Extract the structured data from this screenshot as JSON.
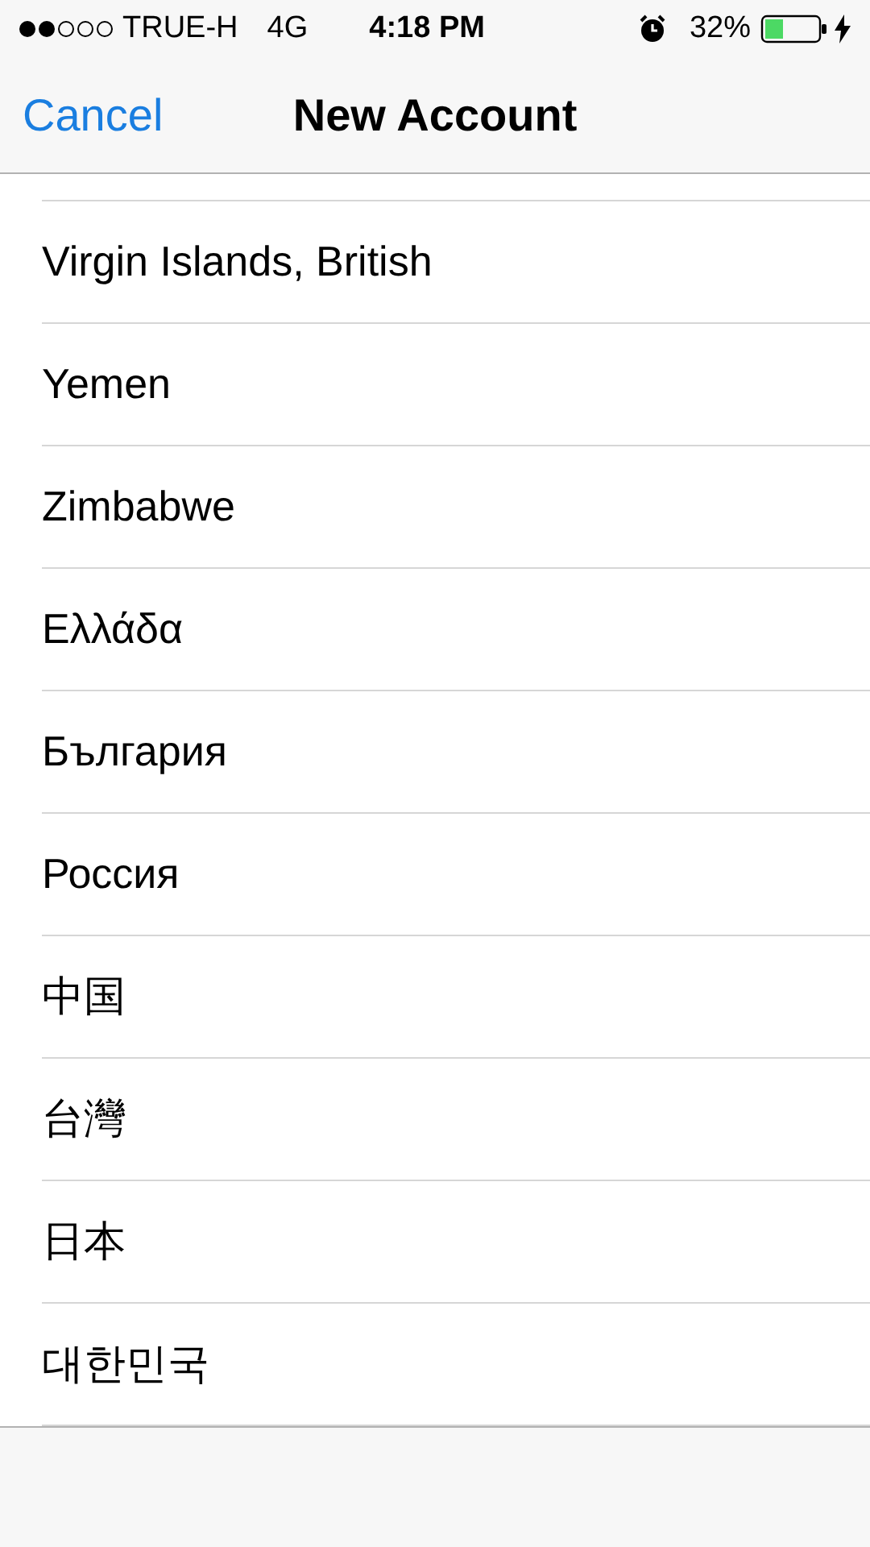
{
  "status_bar": {
    "carrier": "TRUE-H",
    "network": "4G",
    "time": "4:18 PM",
    "battery": "32%"
  },
  "nav_bar": {
    "cancel": "Cancel",
    "title": "New Account"
  },
  "countries": [
    "Virgin Islands, British",
    "Yemen",
    "Zimbabwe",
    "Ελλάδα",
    "България",
    "Россия",
    "中国",
    "台灣",
    "日本",
    "대한민국"
  ]
}
